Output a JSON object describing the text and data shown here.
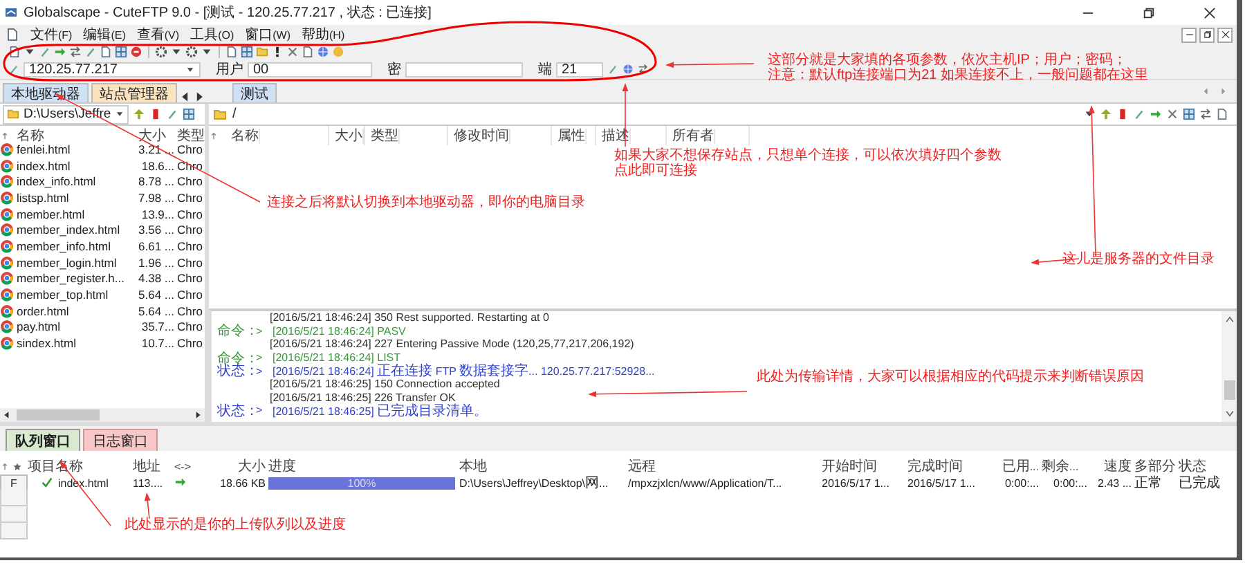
{
  "window": {
    "title": "Globalscape - CuteFTP 9.0 - [测试 - 120.25.77.217 , 状态 : 已连接]"
  },
  "menu": [
    "文件(F)",
    "编辑(E)",
    "查看(V)",
    "工具(O)",
    "窗口(W)",
    "帮助(H)"
  ],
  "quick_connect": {
    "host": "120.25.77.217",
    "user_label": "用户",
    "user": "00",
    "password_label": "密",
    "port_label": "端",
    "port": "21"
  },
  "left_tabs": [
    {
      "label": "本地驱动器",
      "selected": true
    },
    {
      "label": "站点管理器",
      "selected": false
    }
  ],
  "right_tabs": [
    {
      "label": "测试",
      "selected": true
    }
  ],
  "local": {
    "path": "D:\\Users\\Jeffre",
    "columns": [
      "名称",
      "大小",
      "类型"
    ],
    "files": [
      {
        "name": "fenlei.html",
        "size": "3.21 ...",
        "type": "Chro"
      },
      {
        "name": "index.html",
        "size": "18.6...",
        "type": "Chro"
      },
      {
        "name": "index_info.html",
        "size": "8.78 ...",
        "type": "Chro"
      },
      {
        "name": "listsp.html",
        "size": "7.98 ...",
        "type": "Chro"
      },
      {
        "name": "member.html",
        "size": "13.9...",
        "type": "Chro"
      },
      {
        "name": "member_index.html",
        "size": "3.56 ...",
        "type": "Chro"
      },
      {
        "name": "member_info.html",
        "size": "6.61 ...",
        "type": "Chro"
      },
      {
        "name": "member_login.html",
        "size": "1.96 ...",
        "type": "Chro"
      },
      {
        "name": "member_register.h...",
        "size": "4.38 ...",
        "type": "Chro"
      },
      {
        "name": "member_top.html",
        "size": "5.64 ...",
        "type": "Chro"
      },
      {
        "name": "order.html",
        "size": "5.64 ...",
        "type": "Chro"
      },
      {
        "name": "pay.html",
        "size": "35.7...",
        "type": "Chro"
      },
      {
        "name": "sindex.html",
        "size": "10.7...",
        "type": "Chro"
      }
    ]
  },
  "remote": {
    "path": "/",
    "columns": [
      "名称",
      "大小",
      "类型",
      "修改时间",
      "属性",
      "描述",
      "所有者"
    ]
  },
  "log": [
    {
      "kind": "response",
      "text": "[2016/5/21 18:46:24] 350 Rest supported. Restarting at 0"
    },
    {
      "kind": "command",
      "label": "命令：",
      "marker": ">",
      "text": "[2016/5/21 18:46:24] PASV"
    },
    {
      "kind": "response",
      "text": "[2016/5/21 18:46:24] 227 Entering Passive Mode (120,25,77,217,206,192)"
    },
    {
      "kind": "command",
      "label": "命令：",
      "marker": ">",
      "text": "[2016/5/21 18:46:24] LIST"
    },
    {
      "kind": "status",
      "label": "状态：",
      "marker": ">",
      "text": "[2016/5/21 18:46:24] 正在连接 FTP 数据套接字... 120.25.77.217:52928..."
    },
    {
      "kind": "response",
      "text": "[2016/5/21 18:46:25] 150 Connection accepted"
    },
    {
      "kind": "response",
      "text": "[2016/5/21 18:46:25] 226 Transfer OK"
    },
    {
      "kind": "status",
      "label": "状态：",
      "marker": ">",
      "text": "[2016/5/21 18:46:25] 已完成目录清单。"
    }
  ],
  "bottom_tabs": [
    {
      "label": "队列窗口",
      "selected": true
    },
    {
      "label": "日志窗口",
      "selected": false
    }
  ],
  "queue": {
    "columns": [
      "项目名称",
      "地址",
      "<->",
      "大小",
      "进度",
      "本地",
      "远程",
      "开始时间",
      "完成时间",
      "已用...",
      "剩余...",
      "速度",
      "多部分",
      "状态"
    ],
    "rows": [
      {
        "type": "F",
        "name": "index.html",
        "address": "113....",
        "size": "18.66 KB",
        "level": 1,
        "progress": "100%",
        "local": "D:\\Users\\Jeffrey\\Desktop\\网...",
        "remote": "/mpxzjxlcn/www/Application/T...",
        "start": "2016/5/17 1...",
        "finish": "2016/5/17 1...",
        "used": "0:00:...",
        "remaining": "0:00:...",
        "speed": "2.43 ...",
        "multipart": "正常",
        "status": "已完成"
      }
    ]
  },
  "annotations": [
    {
      "lines": [
        "这部分就是大家填的各项参数，依次主机IP；用户；密码；",
        "注意：默认ftp连接端口为21 如果连接不上，一般问题都在这里"
      ]
    },
    {
      "lines": [
        "如果大家不想保存站点，只想单个连接，可以依次填好四个参数",
        "点此即可连接"
      ]
    },
    {
      "lines": [
        "连接之后将默认切换到本地驱动器，即你的电脑目录"
      ]
    },
    {
      "lines": [
        "这儿是服务器的文件目录"
      ]
    },
    {
      "lines": [
        "此处为传输详情，大家可以根据相应的代码提示来判断错误原因"
      ]
    },
    {
      "lines": [
        "此处显示的是你的上传队列以及进度"
      ]
    }
  ]
}
